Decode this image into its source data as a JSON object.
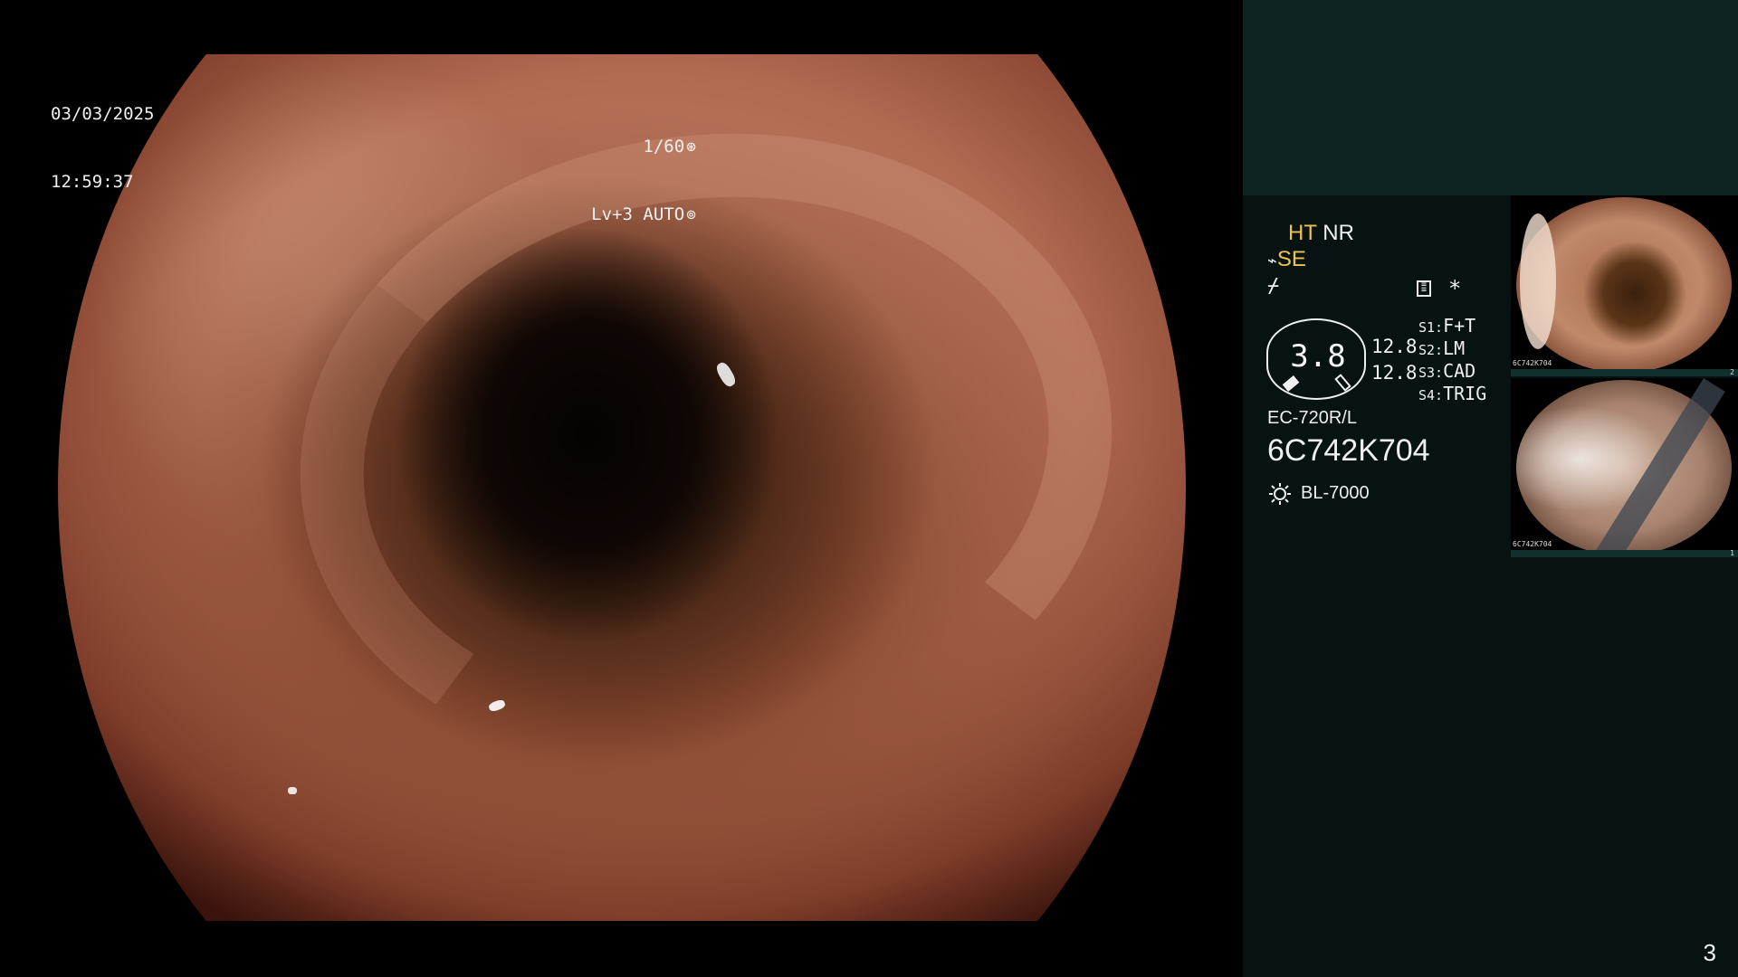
{
  "overlay": {
    "date": "03/03/2025",
    "time": "12:59:37",
    "shutter": "1/60",
    "shutter_icon": "shutter-icon",
    "exposure_level": "Lv+3",
    "exposure_mode": "AUTO",
    "exposure_icon": "iris-icon"
  },
  "panel": {
    "ht_label": "HT",
    "nr_label": "NR",
    "se_label": "SE",
    "se_icon": "wave-icon",
    "pulse_icon_glyph": "⌿",
    "settings_icon": "settings-icon",
    "asterisk": "*",
    "gauge_value": "3.8",
    "value_a": "12.8",
    "value_b": "12.8",
    "slots": [
      {
        "key": "S1:",
        "value": "F+T"
      },
      {
        "key": "S2:",
        "value": "LM"
      },
      {
        "key": "S3:",
        "value": "CAD"
      },
      {
        "key": "S4:",
        "value": "TRIG"
      }
    ],
    "scope_model": "EC-720R/L",
    "scope_serial": "6C742K704",
    "light_icon": "light-source-icon",
    "light_source": "BL-7000",
    "page_number": "3",
    "colors": {
      "panel_bg": "#061312",
      "panel_top_bg": "#0e2423",
      "highlight_text": "#f0c24a"
    }
  },
  "thumbnails": [
    {
      "serial": "6C742K704",
      "index": "2"
    },
    {
      "serial": "6C742K704",
      "index": "1"
    }
  ]
}
